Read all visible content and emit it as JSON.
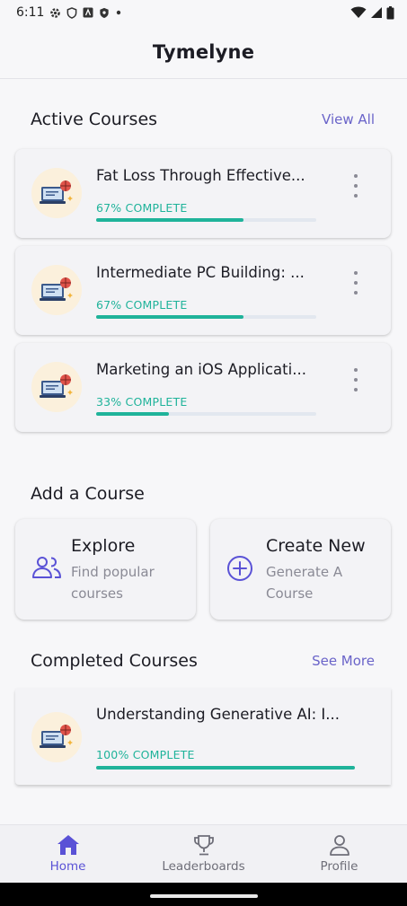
{
  "status_bar": {
    "time": "6:11"
  },
  "app": {
    "title": "Tymelyne"
  },
  "active_courses": {
    "title": "Active Courses",
    "link": "View All",
    "items": [
      {
        "title": "Fat Loss Through Effective...",
        "progress_text": "67% COMPLETE",
        "progress": 0.67
      },
      {
        "title": "Intermediate PC Building: ...",
        "progress_text": "67% COMPLETE",
        "progress": 0.67
      },
      {
        "title": "Marketing an iOS Applicati...",
        "progress_text": "33% COMPLETE",
        "progress": 0.33
      }
    ]
  },
  "add_course": {
    "title": "Add a Course",
    "explore": {
      "title": "Explore",
      "desc": "Find popular courses"
    },
    "create": {
      "title": "Create New",
      "desc": "Generate A Course"
    }
  },
  "completed_courses": {
    "title": "Completed Courses",
    "link": "See More",
    "items": [
      {
        "title": "Understanding Generative AI: I...",
        "progress_text": "100% COMPLETE",
        "progress": 1.0
      }
    ]
  },
  "bottom_nav": {
    "items": [
      {
        "label": "Home",
        "icon": "home-icon",
        "active": true
      },
      {
        "label": "Leaderboards",
        "icon": "trophy-icon",
        "active": false
      },
      {
        "label": "Profile",
        "icon": "person-icon",
        "active": false
      }
    ]
  },
  "colors": {
    "accent": "#5a52d6",
    "link": "#6a64c9",
    "progress": "#1fb39a",
    "thumb_bg": "#fbf0dc"
  }
}
